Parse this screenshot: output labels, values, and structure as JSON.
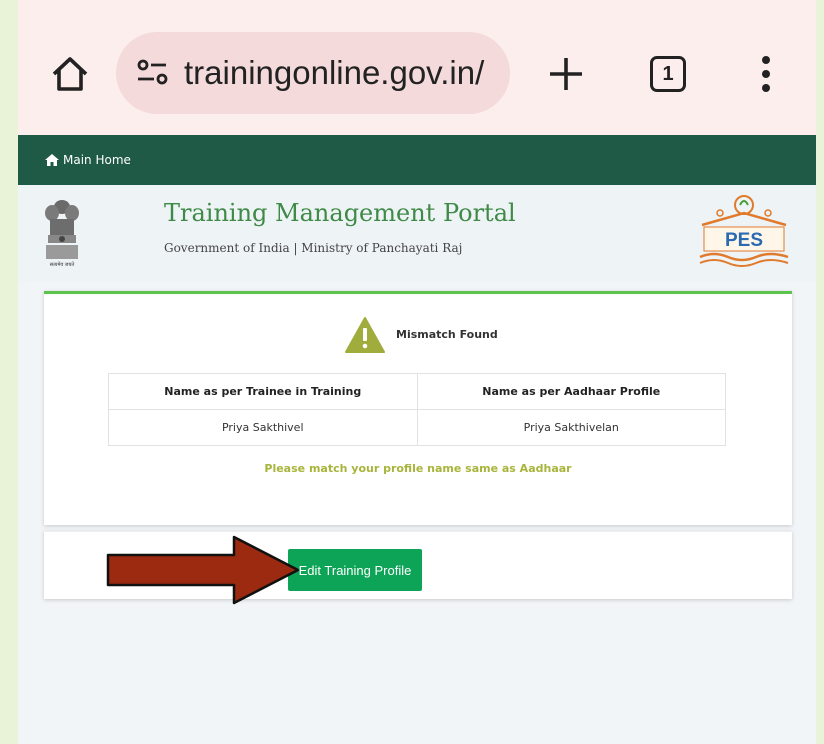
{
  "browser": {
    "url_text": "trainingonline.gov.in/",
    "tab_count": "1",
    "icons": {
      "home": "home-icon",
      "site_settings": "tune-icon",
      "new_tab": "plus-icon",
      "menu": "kebab-menu-icon"
    }
  },
  "nav": {
    "home_label": "Main Home",
    "home_icon": "home-icon"
  },
  "header": {
    "title": "Training Management Portal",
    "subtitle": "Government of India | Ministry of Panchayati Raj",
    "emblem_caption": "सत्यमेव जयते",
    "logo_text": "PES"
  },
  "alert": {
    "icon": "warning-icon",
    "title": "Mismatch Found",
    "columns": [
      "Name as per Trainee in Training",
      "Name as per Aadhaar Profile"
    ],
    "rows": [
      [
        "Priya Sakthivel",
        "Priya Sakthivelan"
      ]
    ],
    "advice": "Please match your profile name same as Aadhaar"
  },
  "actions": {
    "edit_label": "Edit Training Profile"
  },
  "colors": {
    "nav_bg": "#1e5a45",
    "title_green": "#3f8a46",
    "accent_top": "#5cc44c",
    "button_green": "#0ea457",
    "advice_text": "#a8b43a",
    "warning_icon": "#a0ac3c",
    "arrow_fill": "#9c2a10",
    "chrome_bg": "#fdeeee"
  }
}
